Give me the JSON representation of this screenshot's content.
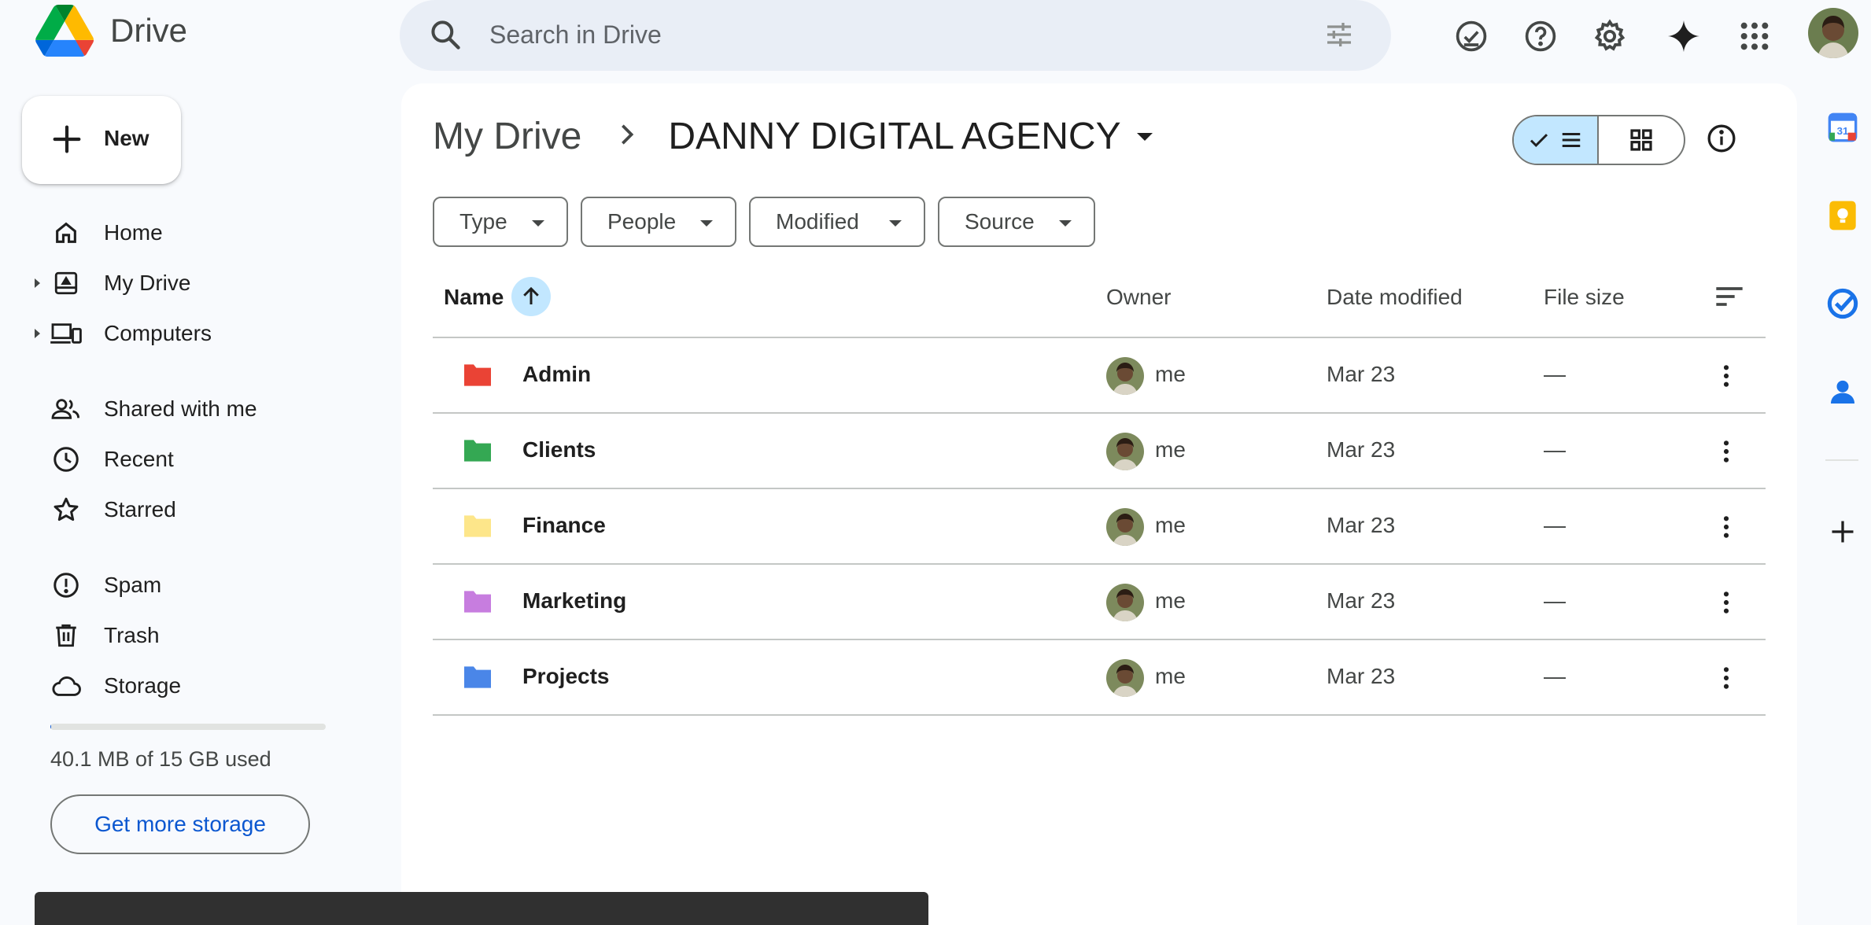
{
  "app": {
    "title": "Drive"
  },
  "search": {
    "placeholder": "Search in Drive"
  },
  "new_button": {
    "label": "New"
  },
  "nav": {
    "items": [
      {
        "label": "Home",
        "icon": "home-icon"
      },
      {
        "label": "My Drive",
        "icon": "my-drive-icon"
      },
      {
        "label": "Computers",
        "icon": "computers-icon"
      },
      {
        "label": "Shared with me",
        "icon": "people-icon"
      },
      {
        "label": "Recent",
        "icon": "clock-icon"
      },
      {
        "label": "Starred",
        "icon": "star-icon"
      },
      {
        "label": "Spam",
        "icon": "spam-icon"
      },
      {
        "label": "Trash",
        "icon": "trash-icon"
      },
      {
        "label": "Storage",
        "icon": "cloud-icon"
      }
    ]
  },
  "storage": {
    "used_text": "40.1 MB of 15 GB used",
    "used_fraction": 0.003,
    "button_label": "Get more storage"
  },
  "breadcrumb": {
    "parent": "My Drive",
    "current": "DANNY DIGITAL AGENCY"
  },
  "filters": {
    "type": "Type",
    "people": "People",
    "modified": "Modified",
    "source": "Source"
  },
  "table": {
    "headers": {
      "name": "Name",
      "owner": "Owner",
      "date_modified": "Date modified",
      "file_size": "File size"
    },
    "rows": [
      {
        "name": "Admin",
        "owner": "me",
        "date": "Mar 23",
        "size": "—",
        "color": "#ea4335"
      },
      {
        "name": "Clients",
        "owner": "me",
        "date": "Mar 23",
        "size": "—",
        "color": "#34a853"
      },
      {
        "name": "Finance",
        "owner": "me",
        "date": "Mar 23",
        "size": "—",
        "color": "#fde68a"
      },
      {
        "name": "Marketing",
        "owner": "me",
        "date": "Mar 23",
        "size": "—",
        "color": "#c77ddf"
      },
      {
        "name": "Projects",
        "owner": "me",
        "date": "Mar 23",
        "size": "—",
        "color": "#4a86e8"
      }
    ]
  },
  "colors": {
    "accent": "#0b57d0",
    "selected_bg": "#c2e7ff",
    "page_bg": "#f8fafd"
  }
}
